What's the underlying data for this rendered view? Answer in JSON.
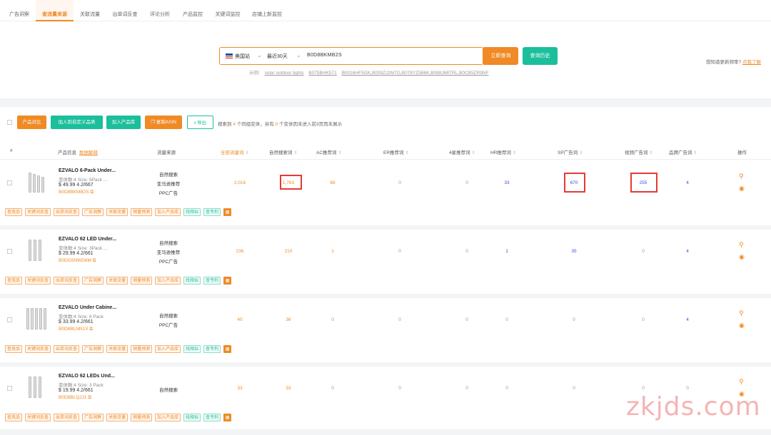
{
  "nav": {
    "tabs": [
      {
        "label": "广告洞察"
      },
      {
        "label": "查流量来源"
      },
      {
        "label": "关联流量"
      },
      {
        "label": "出单词反查"
      },
      {
        "label": "评论分析"
      },
      {
        "label": "产品监控"
      },
      {
        "label": "关键词监控"
      },
      {
        "label": "店铺上新监控"
      }
    ],
    "active_index": 1
  },
  "search": {
    "site": "美国站",
    "range": "最近30天",
    "query": "B0D8BKMB2S",
    "search_label": "立即查询",
    "history_label": "查询历史",
    "examples_label": "示例:",
    "examples": [
      "solar outdoor lights",
      "B075BHK571",
      "B0016HF5GK,B009ZJ2M7G,B078YZ586K,B088J68TRL,B0CB5ZR9NF"
    ]
  },
  "freq_hint": {
    "text": "想知道更新频率?",
    "link": "点我了解"
  },
  "toolbar": {
    "compare": "产品对比",
    "add_category": "加入到自定义品类",
    "add_library": "加入产品库",
    "copy_asin": "复制ASIN",
    "export": "导出",
    "summary_pre": "搜索到",
    "summary_count": "4",
    "summary_mid": "个同组变体，另有",
    "summary_hidden": "0",
    "summary_post": "个变体因未进入前3页而未展示"
  },
  "columns": {
    "index": "#",
    "product": "产品信息",
    "data_explain": "数据解释",
    "source": "流量来源",
    "all": "全部流量词",
    "organic": "自然搜索词",
    "ac": "AC推荐词",
    "er": "ER推荐词",
    "star4": "4星推荐词",
    "hr": "HR推荐词",
    "sp": "SP广告词",
    "video": "视频广告词",
    "brand": "品牌广告词",
    "action": "操作"
  },
  "rows": [
    {
      "name": "EZVALO 6-Pack Under...",
      "meta": "变体数:4   Size: 6Pack ...",
      "price": "$ 49.99    4.2/667",
      "asin": "B0D8BKMB2S",
      "sources": [
        "自然搜索",
        "亚马逊推荐",
        "PPC广告"
      ],
      "all": "2,016",
      "organic": "1,763",
      "ac": "68",
      "er": "0",
      "star4": "0",
      "hr": "33",
      "sp": "670",
      "video": "255",
      "brand": "4"
    },
    {
      "name": "EZVALO 62 LED Under...",
      "meta": "变体数:4   Size: 3Pack ...",
      "price": "$ 29.99    4.2/661",
      "asin": "B0DG5NWD8M",
      "sources": [
        "自然搜索",
        "亚马逊推荐",
        "PPC广告"
      ],
      "all": "236",
      "organic": "210",
      "ac": "1",
      "er": "0",
      "star4": "0",
      "hr": "1",
      "sp": "35",
      "video": "0",
      "brand": "4"
    },
    {
      "name": "EZVALO Under Cabine...",
      "meta": "变体数:4   Size: 6 Pack",
      "price": "$ 33.99    4.2/661",
      "asin": "B0D8BLNN1X",
      "sources": [
        "自然搜索",
        "PPC广告"
      ],
      "all": "40",
      "organic": "36",
      "ac": "0",
      "er": "0",
      "star4": "0",
      "hr": "0",
      "sp": "0",
      "video": "0",
      "brand": "4"
    },
    {
      "name": "EZVALO 62 LEDs Und...",
      "meta": "变体数:4   Size: 3 Pack",
      "price": "$ 19.99    4.2/661",
      "asin": "B0D8BLQJJ1",
      "sources": [
        "自然搜索"
      ],
      "all": "33",
      "organic": "33",
      "ac": "0",
      "er": "0",
      "star4": "0",
      "hr": "0",
      "sp": "0",
      "video": "0",
      "brand": "0"
    }
  ],
  "row_tags": [
    "查竞品",
    "关键词反查",
    "出单词反查",
    "广告洞察",
    "关联流量",
    "销量预测",
    "加入产品库"
  ],
  "row_tags_green": [
    "找相似",
    "查专利"
  ],
  "watermark": "zkjds.com",
  "colors": {
    "accent": "#f08a24",
    "green": "#1bbf9b",
    "blue": "#3a4fd6",
    "highlight": "#e53935"
  }
}
